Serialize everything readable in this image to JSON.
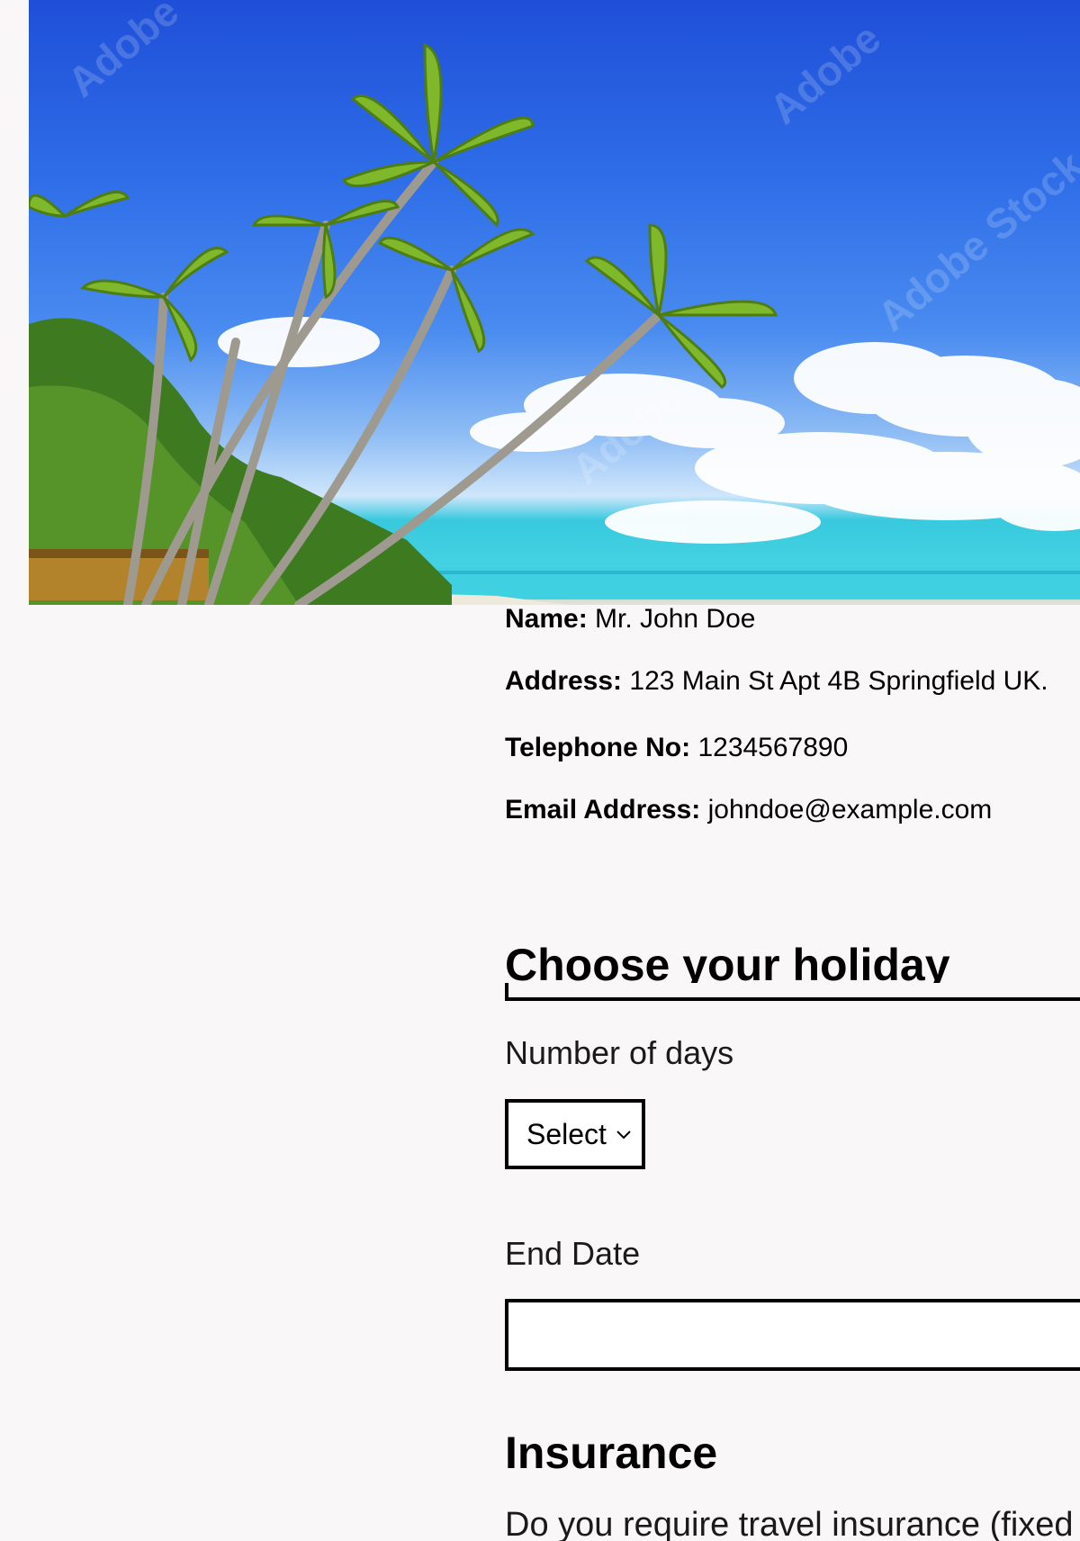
{
  "hero": {
    "image_icon": "tropical-beach-image",
    "watermark": "Adobe Stock"
  },
  "customer": {
    "name_label": "Name:",
    "name_value": " Mr. John Doe",
    "address_label": "Address:",
    "address_value": " 123 Main St Apt 4B Springfield UK.",
    "phone_label": "Telephone No:",
    "phone_value": " 1234567890",
    "email_label": "Email Address:",
    "email_value": " johndoe@example.com"
  },
  "holiday": {
    "title": "Choose your holiday",
    "days_label": "Number of days",
    "days_select_value": "Select",
    "days_select_icon": "chevron-down-icon",
    "end_date_label": "End Date",
    "end_date_value": ""
  },
  "insurance": {
    "title": "Insurance",
    "question": "Do you require travel insurance (fixed"
  }
}
